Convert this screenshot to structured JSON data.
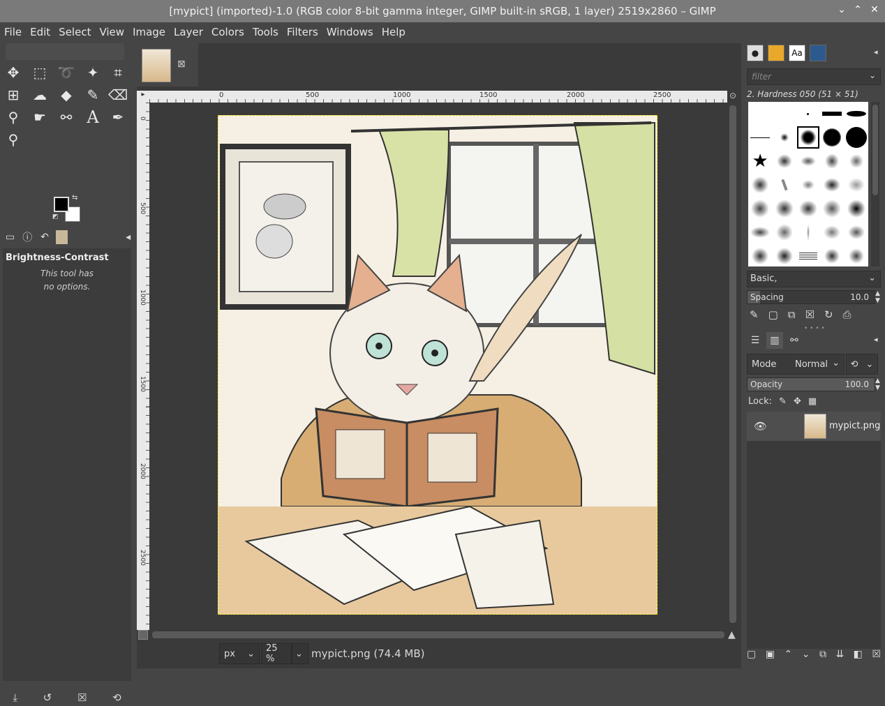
{
  "window": {
    "title": "[mypict] (imported)-1.0 (RGB color 8-bit gamma integer, GIMP built-in sRGB, 1 layer) 2519x2860 – GIMP",
    "controls": [
      "⌄",
      "⌃",
      "✕"
    ]
  },
  "menu": [
    "File",
    "Edit",
    "Select",
    "View",
    "Image",
    "Layer",
    "Colors",
    "Tools",
    "Filters",
    "Windows",
    "Help"
  ],
  "tool_options": {
    "tool_name": "Brightness-Contrast",
    "message_line1": "This tool has",
    "message_line2": "no options."
  },
  "rulers": {
    "h_ticks": [
      "0",
      "500",
      "1000",
      "1500",
      "2000",
      "2500"
    ],
    "v_ticks": [
      "0",
      "500",
      "1000",
      "1500",
      "2000",
      "2500"
    ]
  },
  "statusbar": {
    "unit": "px",
    "zoom": "25 %",
    "info": "mypict.png (74.4 MB)"
  },
  "brushes": {
    "filter_placeholder": "filter",
    "current_brush": "2. Hardness 050 (51 × 51)",
    "tag": "Basic,",
    "spacing_label": "Spacing",
    "spacing_value": "10.0",
    "spacing_fraction": 0.1
  },
  "layers": {
    "mode_label": "Mode",
    "mode_value": "Normal",
    "opacity_label": "Opacity",
    "opacity_value": "100.0",
    "opacity_fraction": 1.0,
    "lock_label": "Lock:",
    "items": [
      {
        "name": "mypict.png",
        "visible": true
      }
    ]
  }
}
